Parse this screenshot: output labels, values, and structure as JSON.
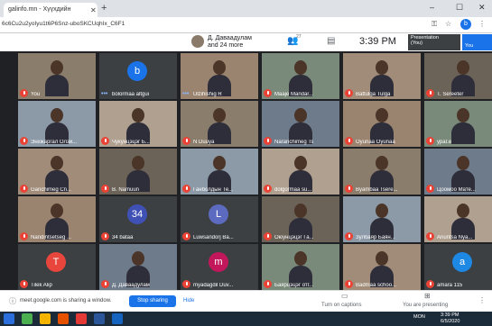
{
  "browser": {
    "tab_title": "galinfo.mn - Хүүхдийн",
    "url": "6c6Cu2u2yoIyu1t6P6Snz-uboSKCUqhIx_C6F1",
    "tab_close": "✕",
    "new_tab": "+",
    "win_min": "–",
    "win_max": "☐",
    "win_close": "✕",
    "profile_letter": "b"
  },
  "meet_top": {
    "host_name": "Д. Даваадулам",
    "others": "and 24 more",
    "people_count": "27",
    "time": "3:39 PM",
    "presentation_label": "Presentation",
    "presentation_sub": "(You)",
    "you_label": "You"
  },
  "tiles": [
    {
      "name": "You",
      "type": "photo",
      "mic": "muted"
    },
    {
      "name": "bolormaa altgui",
      "type": "avatar",
      "letter": "b",
      "color": "#1a73e8",
      "mic": "active"
    },
    {
      "name": "Ulzihishig R",
      "type": "photo",
      "mic": "active"
    },
    {
      "name": "Maaje Mandar...",
      "type": "photo",
      "mic": "muted"
    },
    {
      "name": "Battulga Tulga",
      "type": "photo",
      "mic": "muted"
    },
    {
      "name": "T. Sereeter",
      "type": "photo",
      "mic": "muted"
    },
    {
      "name": "Энхжаргал Олзи...",
      "type": "photo",
      "mic": "muted"
    },
    {
      "name": "Чукунцэцэг Б...",
      "type": "photo",
      "mic": "muted"
    },
    {
      "name": "N Duuya",
      "type": "photo",
      "mic": "muted"
    },
    {
      "name": "Naranchimeg Ts",
      "type": "photo",
      "mic": "muted"
    },
    {
      "name": "Oyunaa Oyunaa",
      "type": "photo",
      "mic": "muted"
    },
    {
      "name": "ураг.е",
      "type": "photo",
      "mic": "muted"
    },
    {
      "name": "Ganchimeg Cn...",
      "type": "photo",
      "mic": "muted"
    },
    {
      "name": "B. Namuun",
      "type": "photo",
      "mic": "muted"
    },
    {
      "name": "Ганболдын Те...",
      "type": "photo",
      "mic": "muted"
    },
    {
      "name": "dolgormaa su...",
      "type": "photo",
      "mic": "muted"
    },
    {
      "name": "Byambaa Tsere...",
      "type": "photo",
      "mic": "muted"
    },
    {
      "name": "Цоомоо Мате...",
      "type": "photo",
      "mic": "muted"
    },
    {
      "name": "Nandintsetseg ...",
      "type": "photo",
      "mic": "muted"
    },
    {
      "name": "34 bataa",
      "type": "avatar",
      "letter": "34",
      "color": "#3f51b5",
      "mic": "muted"
    },
    {
      "name": "Luwsandorj Ba...",
      "type": "avatar",
      "letter": "L",
      "color": "#5c6bc0",
      "mic": "muted"
    },
    {
      "name": "Оюунцэцэг Га...",
      "type": "photo",
      "mic": "muted"
    },
    {
      "name": "Зулбаяр Баян...",
      "type": "photo",
      "mic": "muted"
    },
    {
      "name": "Ariuntsa Nya...",
      "type": "photo",
      "mic": "muted"
    },
    {
      "name": "Tilek Alip",
      "type": "avatar",
      "letter": "T",
      "color": "#e8453c",
      "mic": "muted"
    },
    {
      "name": "Д. Даваадулам",
      "type": "photo",
      "mic": "muted"
    },
    {
      "name": "myadagdil Duv...",
      "type": "avatar",
      "letter": "m",
      "color": "#c2185b",
      "mic": "muted"
    },
    {
      "name": "Баярцэцэг отг...",
      "type": "photo",
      "mic": "muted"
    },
    {
      "name": "Badmaa schoo...",
      "type": "photo",
      "mic": "muted"
    },
    {
      "name": "amara 115",
      "type": "avatar",
      "letter": "a",
      "color": "#1e88e5",
      "mic": "muted"
    }
  ],
  "meet_bottom": {
    "share_message": "meet.google.com is sharing a window.",
    "stop_label": "Stop sharing",
    "hide_label": "Hide",
    "captions_label": "Turn on captions",
    "presenting_label": "You are presenting"
  },
  "taskbar": {
    "tray_lang": "MON",
    "tray_time": "3:39 PM",
    "tray_date": "6/5/2020"
  },
  "colors": {
    "grid_bg": "#202124",
    "tile_bg": "#3c4043",
    "accent": "#1a73e8",
    "muted": "#ea4335"
  }
}
